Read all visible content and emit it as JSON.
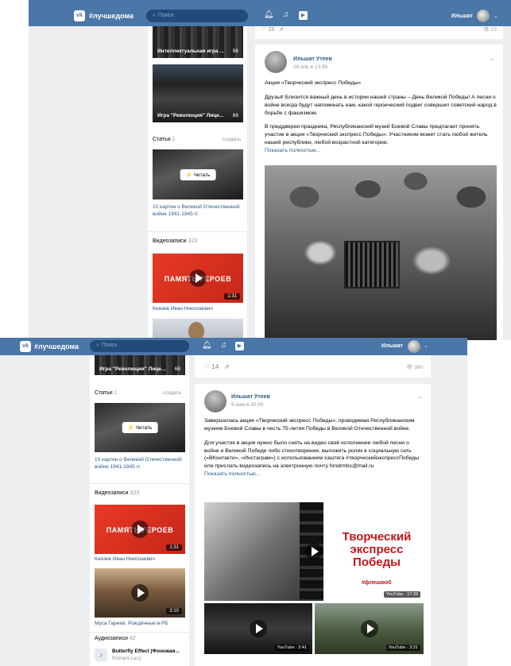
{
  "header": {
    "brand": "#лучшедома",
    "search_placeholder": "Поиск",
    "user_name": "Ильшат"
  },
  "screen1": {
    "sidebar": {
      "photo1_caption": "Интеллектуальная игра ...",
      "photo1_count": "96",
      "photo2_caption": "Игра \"Революция\" Лице...",
      "photo2_count": "68",
      "articles_label": "Статьи",
      "articles_count": "1",
      "create_link": "создать",
      "read_button": "Читать",
      "article_title": "10 картин о Великой Отечественной войне 1941-1945 гг.",
      "videos_label": "Видеозаписи",
      "videos_count": "323",
      "video1_title_overlay": "ПАМЯТЬ ГЕРОЕВ",
      "video1_duration": "1:31",
      "video1_title": "Князев Иван Николаевич"
    },
    "top_likes": "23",
    "top_views": "23",
    "post": {
      "author": "Ильшат Утеев",
      "date": "28 апр в 13:36",
      "p1": "Акция «Творческий экспресс Победы»",
      "p2": "Друзья! Близится важный день в истории нашей страны – День Великой Победы! А песни о войне всегда будут напоминать нам, какой героический подвиг совершил советский народ в борьбе с фашизмом.",
      "p3": "В преддверии праздника, Республиканский музей Боевой Славы предлагает принять участие в акции «Творческий экспресс Победы». Участником может стать любой житель нашей республики, любой возрастной категории.",
      "more": "Показать полностью..."
    }
  },
  "screen2": {
    "sidebar": {
      "photo2_caption": "Игра \"Революция\" Лице...",
      "photo2_count": "68",
      "articles_label": "Статьи",
      "articles_count": "1",
      "create_link": "создать",
      "read_button": "Читать",
      "article_title": "10 картин о Великой Отечественной войне 1941-1945 гг.",
      "videos_label": "Видеозаписи",
      "videos_count": "323",
      "video1_title_overlay": "ПАМЯТЬ ГЕРОЕВ",
      "video1_duration": "1:31",
      "video1_title": "Князев Иван Николаевич",
      "video2_duration": "3:10",
      "video2_title": "Муса Гареев. Рождённые в РБ",
      "audio_label": "Аудиозаписи",
      "audio_count": "42",
      "audio_title": "Butterfly Effect (Фоновая...",
      "audio_artist": "Richard Lacy"
    },
    "likes": "14",
    "views": "390",
    "post": {
      "author": "Ильшат Утеев",
      "date": "9 мая в 20:00",
      "p1": "Завершилась акция «Творческий экспресс Победы», проводимая Республиканским музеем Боевой Славы в честь 75-летия Победы в Великой Отечественной войне.",
      "p2": "Для участия в акции нужно было снять на видео своё исполнение любой песни о войне и Великой Победе либо стихотворение, выложить ролик в социальную сеть («ВКонтакте», «Инстаграм») с использованием хэштега #творческийэкспрессПобеды или прислать видеозапись на электронную почту fondrmbs@mail.ru",
      "more": "Показать полностью...",
      "poster_title": "Творческий экспресс Победы",
      "poster_tag": "#флешмоб",
      "video_main_duration": "YouTube · 17:39",
      "video_a_duration": "YouTube · 3:41",
      "video_b_duration": "YouTube · 3:21"
    }
  },
  "colors": {
    "header": "#4a76a8",
    "link": "#2a5885",
    "background": "#edeef0",
    "poster_red": "#c4161c"
  }
}
